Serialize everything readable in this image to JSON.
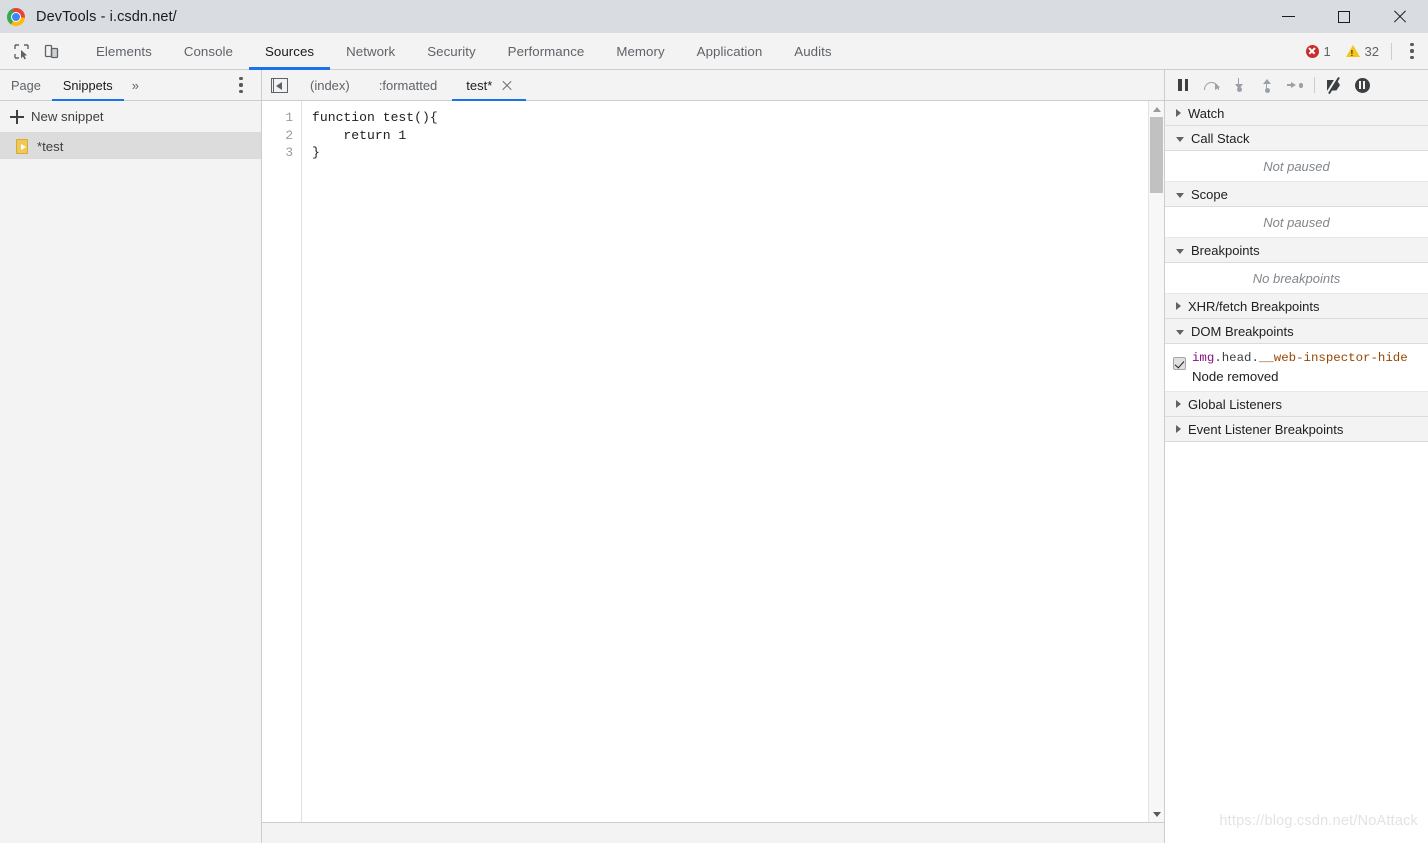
{
  "window": {
    "title": "DevTools - i.csdn.net/",
    "logo_icon": "chrome-logo-icon",
    "controls": {
      "minimize": "minimize-icon",
      "maximize": "maximize-icon",
      "close": "close-icon"
    }
  },
  "toolbar": {
    "inspect_icon": "inspect-element-icon",
    "device_icon": "device-toolbar-icon",
    "tabs": [
      {
        "label": "Elements",
        "active": false
      },
      {
        "label": "Console",
        "active": false
      },
      {
        "label": "Sources",
        "active": true
      },
      {
        "label": "Network",
        "active": false
      },
      {
        "label": "Security",
        "active": false
      },
      {
        "label": "Performance",
        "active": false
      },
      {
        "label": "Memory",
        "active": false
      },
      {
        "label": "Application",
        "active": false
      },
      {
        "label": "Audits",
        "active": false
      }
    ],
    "error_count": "1",
    "warning_count": "32",
    "error_icon": "error-circle-icon",
    "warning_icon": "warning-triangle-icon",
    "menu_icon": "kebab-menu-icon"
  },
  "navigator": {
    "tabs": [
      {
        "label": "Page",
        "active": false
      },
      {
        "label": "Snippets",
        "active": true
      }
    ],
    "more_icon": "chevron-double-right-icon",
    "menu_icon": "kebab-menu-icon",
    "new_snippet_label": "New snippet",
    "new_snippet_icon": "plus-icon",
    "snippets": [
      {
        "name": "*test",
        "icon": "snippet-file-icon",
        "selected": true
      }
    ]
  },
  "editor": {
    "collapse_icon": "collapse-sidebar-icon",
    "tabs": [
      {
        "label": "(index)",
        "active": false,
        "closable": false
      },
      {
        "label": ":formatted",
        "active": false,
        "closable": false
      },
      {
        "label": "test*",
        "active": true,
        "closable": true
      }
    ],
    "close_icon": "close-tab-icon",
    "line_numbers": [
      "1",
      "2",
      "3"
    ],
    "code_lines": [
      "function test(){",
      "    return 1",
      "}"
    ],
    "scrollbar": {
      "up_icon": "scroll-up-arrow-icon",
      "down_icon": "scroll-down-arrow-icon"
    }
  },
  "debugger": {
    "controls": [
      {
        "name": "resume-pause-button",
        "icon": "pause-icon"
      },
      {
        "name": "step-over-button",
        "icon": "step-over-icon"
      },
      {
        "name": "step-into-button",
        "icon": "step-into-icon"
      },
      {
        "name": "step-out-button",
        "icon": "step-out-icon"
      },
      {
        "name": "step-button",
        "icon": "step-icon"
      },
      {
        "name": "deactivate-breakpoints-button",
        "icon": "deactivate-breakpoints-icon"
      },
      {
        "name": "pause-on-exceptions-button",
        "icon": "pause-on-exceptions-icon"
      }
    ],
    "sections": [
      {
        "title": "Watch",
        "expanded": false
      },
      {
        "title": "Call Stack",
        "expanded": true,
        "empty_text": "Not paused"
      },
      {
        "title": "Scope",
        "expanded": true,
        "empty_text": "Not paused"
      },
      {
        "title": "Breakpoints",
        "expanded": true,
        "empty_text": "No breakpoints"
      },
      {
        "title": "XHR/fetch Breakpoints",
        "expanded": false
      },
      {
        "title": "DOM Breakpoints",
        "expanded": true
      },
      {
        "title": "Global Listeners",
        "expanded": false
      },
      {
        "title": "Event Listener Breakpoints",
        "expanded": false
      }
    ],
    "dom_breakpoint": {
      "checked": true,
      "selector_tag": "img",
      "selector_dot1": ".",
      "selector_mid": "head",
      "selector_dot2": ".",
      "selector_class": "__web-inspector-hide",
      "type": "Node removed"
    }
  },
  "watermark": "https://blog.csdn.net/NoAttack"
}
